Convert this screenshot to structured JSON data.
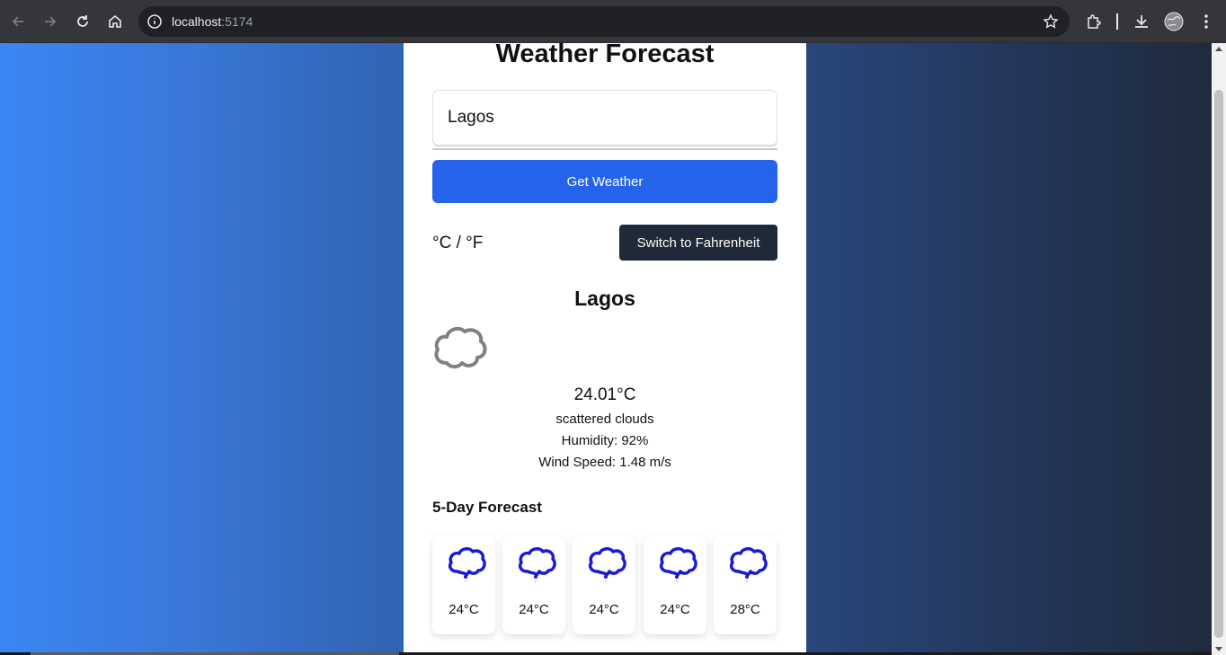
{
  "browser": {
    "url_host": "localhost",
    "url_port": ":5174"
  },
  "app": {
    "title": "Weather Forecast",
    "search": {
      "value": "Lagos",
      "placeholder": ""
    },
    "get_weather_label": "Get Weather",
    "unit_label": "°C / °F",
    "switch_label": "Switch to Fahrenheit"
  },
  "current": {
    "city": "Lagos",
    "icon": "cloud-icon",
    "temp": "24.01°C",
    "description": "scattered clouds",
    "humidity": "Humidity: 92%",
    "wind": "Wind Speed: 1.48 m/s"
  },
  "forecast": {
    "title": "5-Day Forecast",
    "days": [
      {
        "temp": "24°C",
        "icon": "rain-cloud-icon"
      },
      {
        "temp": "24°C",
        "icon": "rain-cloud-icon"
      },
      {
        "temp": "24°C",
        "icon": "rain-cloud-icon"
      },
      {
        "temp": "24°C",
        "icon": "rain-cloud-icon"
      },
      {
        "temp": "28°C",
        "icon": "rain-cloud-icon"
      }
    ]
  },
  "colors": {
    "primary_button": "#2563eb",
    "dark_button": "#1f2937",
    "forecast_icon": "#1a1ad6"
  }
}
